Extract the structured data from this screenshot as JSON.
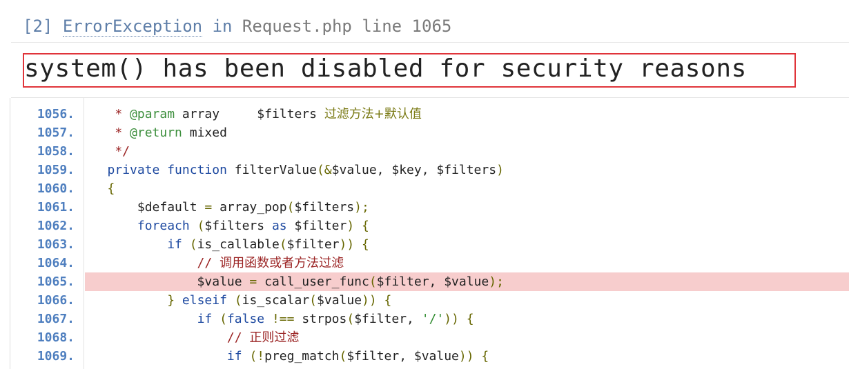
{
  "error_header": {
    "index": "[2]",
    "exception_name": "ErrorException",
    "in_word": "in",
    "location": "Request.php line 1065"
  },
  "message": "system() has been disabled for security reasons",
  "colors": {
    "highlight_row": "#f7cdcd",
    "message_border": "#e0343a",
    "line_number": "#4f7fbf"
  },
  "source": {
    "highlight_line": "1065.",
    "lines": [
      {
        "no": "1056.",
        "text": "    * @param array     $filters 过滤方法+默认值"
      },
      {
        "no": "1057.",
        "text": "    * @return mixed"
      },
      {
        "no": "1058.",
        "text": "    */"
      },
      {
        "no": "1059.",
        "text": "   private function filterValue(&$value, $key, $filters)"
      },
      {
        "no": "1060.",
        "text": "   {"
      },
      {
        "no": "1061.",
        "text": "       $default = array_pop($filters);"
      },
      {
        "no": "1062.",
        "text": "       foreach ($filters as $filter) {"
      },
      {
        "no": "1063.",
        "text": "           if (is_callable($filter)) {"
      },
      {
        "no": "1064.",
        "text": "               // 调用函数或者方法过滤"
      },
      {
        "no": "1065.",
        "text": "               $value = call_user_func($filter, $value);"
      },
      {
        "no": "1066.",
        "text": "           } elseif (is_scalar($value)) {"
      },
      {
        "no": "1067.",
        "text": "               if (false !== strpos($filter, '/')) {"
      },
      {
        "no": "1068.",
        "text": "                   // 正则过滤"
      },
      {
        "no": "1069.",
        "text": "                   if (!preg_match($filter, $value)) {"
      }
    ]
  }
}
